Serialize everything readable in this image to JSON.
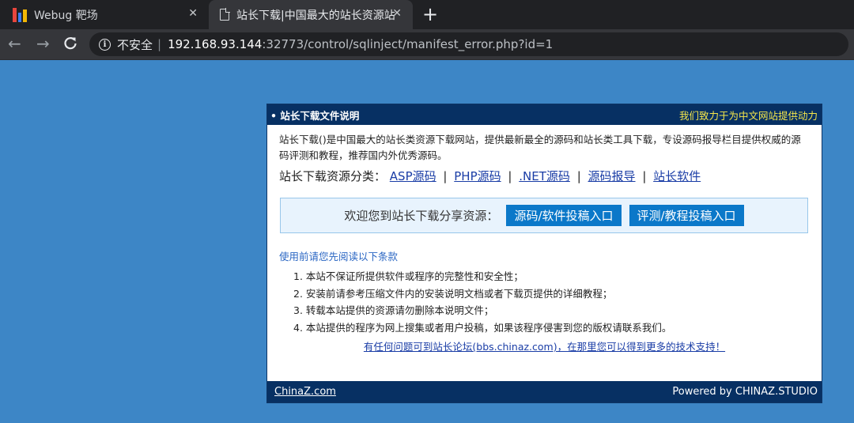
{
  "browser": {
    "tabs": [
      {
        "title": "Webug 靶场",
        "close": "✕"
      },
      {
        "title": "站长下载|中国最大的站长资源站",
        "close": "✕"
      }
    ],
    "new_tab": "+",
    "nav": {
      "back": "←",
      "forward": "→",
      "reload": "C"
    },
    "address": {
      "security_label": "不安全",
      "host": "192.168.93.144",
      "rest": ":32773/control/sqlinject/manifest_error.php?id=1"
    }
  },
  "panel": {
    "title": "• 站长下载文件说明",
    "slogan": "我们致力于为中文网站提供动力",
    "intro": "站长下载()是中国最大的站长类资源下载网站，提供最新最全的源码和站长类工具下载，专设源码报导栏目提供权威的源码评测和教程，推荐国内外优秀源码。",
    "category_label": "站长下载资源分类：",
    "categories": [
      "ASP源码",
      "PHP源码",
      ".NET源码",
      "源码报导",
      "站长软件"
    ],
    "category_separator": "|",
    "welcome_text": "欢迎您到站长下载分享资源：",
    "buttons": [
      "源码/软件投稿入口",
      "评测/教程投稿入口"
    ],
    "notice_title": "使用前请您先阅读以下条款",
    "notices": [
      "1. 本站不保证所提供软件或程序的完整性和安全性；",
      "2. 安装前请参考压缩文件内的安装说明文档或者下载页提供的详细教程；",
      "3. 转载本站提供的资源请勿删除本说明文件；",
      "4. 本站提供的程序为网上搜集或者用户投稿，如果该程序侵害到您的版权请联系我们。"
    ],
    "help_link": "有任何问题可到站长论坛(bbs.chinaz.com)，在那里您可以得到更多的技术支持！",
    "footer_left": "ChinaZ.com",
    "footer_right": "Powered by CHINAZ.STUDIO"
  },
  "colors": {
    "page_background": "#3d86c6",
    "panel_header": "#073063",
    "slogan": "#f5e64a",
    "button": "#0b78c9"
  }
}
